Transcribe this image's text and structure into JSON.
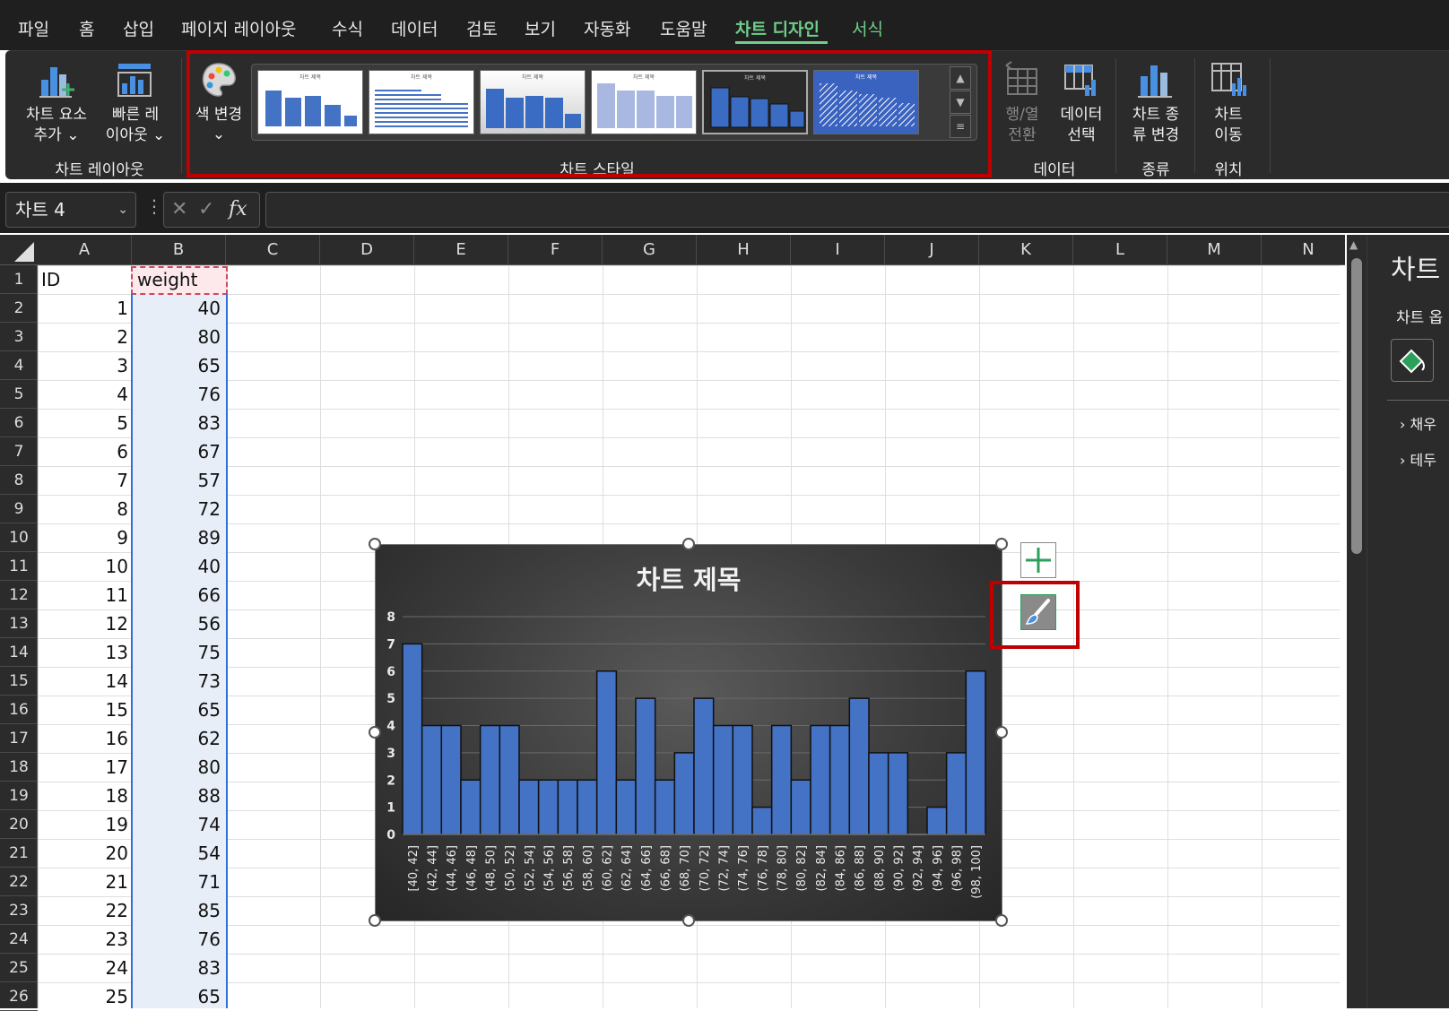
{
  "menu_tabs": [
    {
      "label": "파일",
      "active": false
    },
    {
      "label": "홈",
      "active": false
    },
    {
      "label": "삽입",
      "active": false
    },
    {
      "label": "페이지 레이아웃",
      "active": false
    },
    {
      "label": "수식",
      "active": false
    },
    {
      "label": "데이터",
      "active": false
    },
    {
      "label": "검토",
      "active": false
    },
    {
      "label": "보기",
      "active": false
    },
    {
      "label": "자동화",
      "active": false
    },
    {
      "label": "도움말",
      "active": false
    },
    {
      "label": "차트 디자인",
      "active": true
    },
    {
      "label": "서식",
      "active": false
    }
  ],
  "ribbon": {
    "add_chart_element": {
      "line1": "차트 요소",
      "line2": "추가"
    },
    "quick_layout": {
      "line1": "빠른 레",
      "line2": "이아웃"
    },
    "chart_layouts_group": "차트 레이아웃",
    "change_colors": "색 변경",
    "chart_styles_group": "차트 스타일",
    "switch_row_col": {
      "line1": "행/열",
      "line2": "전환"
    },
    "select_data": {
      "line1": "데이터",
      "line2": "선택"
    },
    "data_group": "데이터",
    "change_chart_type": {
      "line1": "차트 종",
      "line2": "류 변경"
    },
    "type_group": "종류",
    "move_chart": {
      "line1": "차트",
      "line2": "이동"
    },
    "location_group": "위치"
  },
  "style_thumbnails": [
    {
      "title": "차트 제목",
      "theme": "light"
    },
    {
      "title": "차트 제목",
      "theme": "light-lines"
    },
    {
      "title": "차트 제목",
      "theme": "gradient"
    },
    {
      "title": "차트 제목",
      "theme": "light-faded"
    },
    {
      "title": "차트 제목",
      "theme": "dark-selected"
    },
    {
      "title": "차트 제목",
      "theme": "blue-hatched"
    }
  ],
  "formula_bar": {
    "name_box": "차트 4",
    "fx": "fx",
    "value": ""
  },
  "columns": [
    "A",
    "B",
    "C",
    "D",
    "E",
    "F",
    "G",
    "H",
    "I",
    "J",
    "K",
    "L",
    "M",
    "N"
  ],
  "sheet": {
    "headers": [
      "ID",
      "weight"
    ],
    "rows": [
      [
        "1",
        "40"
      ],
      [
        "2",
        "80"
      ],
      [
        "3",
        "65"
      ],
      [
        "4",
        "76"
      ],
      [
        "5",
        "83"
      ],
      [
        "6",
        "67"
      ],
      [
        "7",
        "57"
      ],
      [
        "8",
        "72"
      ],
      [
        "9",
        "89"
      ],
      [
        "10",
        "40"
      ],
      [
        "11",
        "66"
      ],
      [
        "12",
        "56"
      ],
      [
        "13",
        "75"
      ],
      [
        "14",
        "73"
      ],
      [
        "15",
        "65"
      ],
      [
        "16",
        "62"
      ],
      [
        "17",
        "80"
      ],
      [
        "18",
        "88"
      ],
      [
        "19",
        "74"
      ],
      [
        "20",
        "54"
      ],
      [
        "21",
        "71"
      ],
      [
        "22",
        "85"
      ],
      [
        "23",
        "76"
      ],
      [
        "24",
        "83"
      ],
      [
        "25",
        "65"
      ]
    ]
  },
  "row_numbers": [
    "1",
    "2",
    "3",
    "4",
    "5",
    "6",
    "7",
    "8",
    "9",
    "10",
    "11",
    "12",
    "13",
    "14",
    "15",
    "16",
    "17",
    "18",
    "19",
    "20",
    "21",
    "22",
    "23",
    "24",
    "25",
    "26"
  ],
  "side_panel": {
    "title": "차트",
    "subtitle": "차트 옵",
    "item1": "채우",
    "item2": "테두"
  },
  "chart_data": {
    "type": "bar",
    "title": "차트 제목",
    "categories": [
      "[40, 42]",
      "(42, 44]",
      "(44, 46]",
      "(46, 48]",
      "(48, 50]",
      "(50, 52]",
      "(52, 54]",
      "(54, 56]",
      "(56, 58]",
      "(58, 60]",
      "(60, 62]",
      "(62, 64]",
      "(64, 66]",
      "(66, 68]",
      "(68, 70]",
      "(70, 72]",
      "(72, 74]",
      "(74, 76]",
      "(76, 78]",
      "(78, 80]",
      "(80, 82]",
      "(82, 84]",
      "(84, 86]",
      "(86, 88]",
      "(88, 90]",
      "(90, 92]",
      "(92, 94]",
      "(94, 96]",
      "(96, 98]",
      "(98, 100]"
    ],
    "values": [
      7,
      4,
      4,
      2,
      4,
      4,
      2,
      2,
      2,
      2,
      6,
      2,
      5,
      2,
      3,
      5,
      4,
      4,
      1,
      4,
      2,
      4,
      4,
      5,
      3,
      3,
      0,
      1,
      3,
      6
    ],
    "ylim": [
      0,
      8
    ],
    "yticks": [
      "0",
      "1",
      "2",
      "3",
      "4",
      "5",
      "6",
      "7",
      "8"
    ],
    "grid": true,
    "bar_color": "#4472c4",
    "background": "dark-gradient"
  },
  "colors": {
    "accent_green": "#6fcf8a",
    "highlight_red": "#c00000",
    "selection_blue": "#2f6fd6"
  }
}
